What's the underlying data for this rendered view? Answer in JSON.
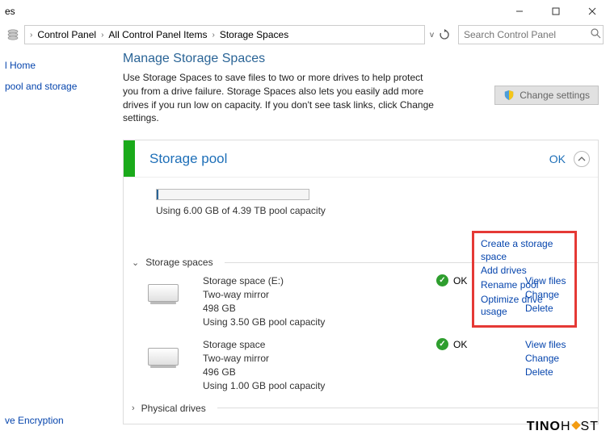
{
  "window": {
    "title_frag": "es"
  },
  "breadcrumb": {
    "seg1": "Control Panel",
    "seg2": "All Control Panel Items",
    "seg3": "Storage Spaces"
  },
  "search": {
    "placeholder": "Search Control Panel"
  },
  "sidebar": {
    "link1": "l Home",
    "link2": "pool and storage",
    "link3": "ve Encryption"
  },
  "page": {
    "heading": "Manage Storage Spaces",
    "desc": "Use Storage Spaces to save files to two or more drives to help protect you from a drive failure. Storage Spaces also lets you easily add more drives if you run low on capacity. If you don't see task links, click Change settings.",
    "change_btn": "Change settings"
  },
  "pool": {
    "title": "Storage pool",
    "status": "OK",
    "usage_text": "Using 6.00 GB of 4.39 TB pool capacity",
    "links": {
      "create": "Create a storage space",
      "add": "Add drives",
      "rename": "Rename pool",
      "opt": "Optimize drive usage"
    },
    "spaces_header": "Storage spaces",
    "phys_header": "Physical drives",
    "spaces": [
      {
        "name": "Storage space (E:)",
        "type": "Two-way mirror",
        "size": "498 GB",
        "usage": "Using 3.50 GB pool capacity",
        "status": "OK",
        "a1": "View files",
        "a2": "Change",
        "a3": "Delete"
      },
      {
        "name": "Storage space",
        "type": "Two-way mirror",
        "size": "496 GB",
        "usage": "Using 1.00 GB pool capacity",
        "status": "OK",
        "a1": "View files",
        "a2": "Change",
        "a3": "Delete"
      }
    ]
  },
  "watermark": {
    "t1": "TINO",
    "t2": "H",
    "t3": "ST"
  }
}
